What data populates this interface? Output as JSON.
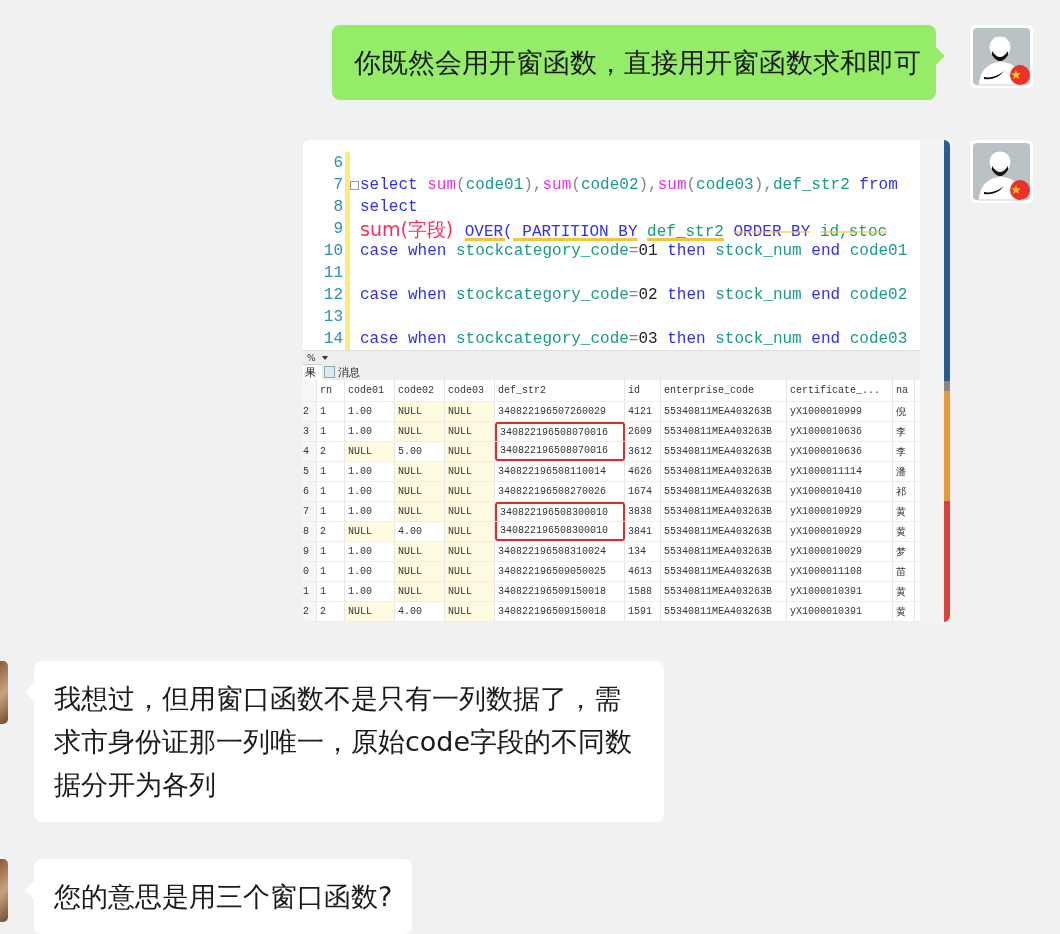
{
  "messages": [
    {
      "kind": "outgoing",
      "text": "你既然会用开窗函数，直接用开窗函数求和即可"
    },
    {
      "kind": "outgoing_image",
      "editor": {
        "lines": [
          {
            "number": "6",
            "collapsible": false
          },
          {
            "number": "7",
            "collapsible": true,
            "tokens": [
              {
                "kind": "keyword",
                "text": "select "
              },
              {
                "kind": "func",
                "text": "sum"
              },
              {
                "kind": "op",
                "text": "("
              },
              {
                "kind": "ident",
                "text": "code01"
              },
              {
                "kind": "op",
                "text": "),"
              },
              {
                "kind": "func",
                "text": "sum"
              },
              {
                "kind": "op",
                "text": "("
              },
              {
                "kind": "ident",
                "text": "code02"
              },
              {
                "kind": "op",
                "text": "),"
              },
              {
                "kind": "func",
                "text": "sum"
              },
              {
                "kind": "op",
                "text": "("
              },
              {
                "kind": "ident",
                "text": "code03"
              },
              {
                "kind": "op",
                "text": "),"
              },
              {
                "kind": "ident",
                "text": "def_str2 "
              },
              {
                "kind": "keyword",
                "text": "from"
              }
            ]
          },
          {
            "number": "8",
            "collapsible": false,
            "tokens": [
              {
                "kind": "keyword",
                "text": "select"
              }
            ]
          },
          {
            "number": "9",
            "collapsible": false,
            "tokens": [
              {
                "kind": "annotation",
                "text": "sum(字段)",
                "underlined": false,
                "struck_out": false
              },
              {
                "kind": "keyword",
                "text": "OVER( PARTITION BY",
                "underlined": true,
                "struck_out": false
              },
              {
                "kind": "ident",
                "text": "def_str2",
                "underlined": true,
                "struck_out": false
              },
              {
                "kind": "keyword",
                "text": "ORDER BY",
                "underlined": false,
                "struck_out": true
              },
              {
                "kind": "ident",
                "text": "id,stoc",
                "underlined": false,
                "struck_out": true
              }
            ]
          },
          {
            "number": "10",
            "collapsible": false,
            "tokens": [
              {
                "kind": "keyword",
                "text": "case when "
              },
              {
                "kind": "ident",
                "text": "stockcategory_code"
              },
              {
                "kind": "op",
                "text": "="
              },
              {
                "kind": "number",
                "text": "01"
              },
              {
                "kind": "keyword",
                "text": " then "
              },
              {
                "kind": "ident",
                "text": "stock_num "
              },
              {
                "kind": "keyword",
                "text": "end "
              },
              {
                "kind": "ident",
                "text": "code01"
              }
            ]
          },
          {
            "number": "11",
            "collapsible": false
          },
          {
            "number": "12",
            "collapsible": false,
            "tokens": [
              {
                "kind": "keyword",
                "text": "case when "
              },
              {
                "kind": "ident",
                "text": "stockcategory_code"
              },
              {
                "kind": "op",
                "text": "="
              },
              {
                "kind": "number",
                "text": "02"
              },
              {
                "kind": "keyword",
                "text": " then "
              },
              {
                "kind": "ident",
                "text": "stock_num "
              },
              {
                "kind": "keyword",
                "text": "end "
              },
              {
                "kind": "ident",
                "text": "code02"
              }
            ]
          },
          {
            "number": "13",
            "collapsible": false
          },
          {
            "number": "14",
            "collapsible": false,
            "tokens": [
              {
                "kind": "keyword",
                "text": "case when "
              },
              {
                "kind": "ident",
                "text": "stockcategory_code"
              },
              {
                "kind": "op",
                "text": "="
              },
              {
                "kind": "number",
                "text": "03"
              },
              {
                "kind": "keyword",
                "text": " then "
              },
              {
                "kind": "ident",
                "text": "stock_num "
              },
              {
                "kind": "keyword",
                "text": "end "
              },
              {
                "kind": "ident",
                "text": "code03"
              }
            ]
          }
        ]
      },
      "zoom": "%",
      "tabs": [
        {
          "label": "果",
          "selected": true
        },
        {
          "label": "消息",
          "selected": false
        }
      ],
      "grid": {
        "columns": [
          "rn",
          "code01",
          "code02",
          "code03",
          "def_str2",
          "id",
          "enterprise_code",
          "certificate_...",
          "na"
        ],
        "rows": [
          {
            "number": "2",
            "cells": [
              {
                "text": "1",
                "is_null": false,
                "boxed": false
              },
              {
                "text": "1.00",
                "is_null": false,
                "boxed": false
              },
              {
                "text": "NULL",
                "is_null": true,
                "boxed": false
              },
              {
                "text": "NULL",
                "is_null": true,
                "boxed": false
              },
              {
                "text": "340822196507260029",
                "is_null": false,
                "boxed": false
              },
              {
                "text": "4121",
                "is_null": false,
                "boxed": false
              },
              {
                "text": "55340811MEA403263B",
                "is_null": false,
                "boxed": false
              },
              {
                "text": "yX1000010999",
                "is_null": false,
                "boxed": false
              },
              {
                "text": "倪",
                "is_null": false,
                "boxed": false
              }
            ]
          },
          {
            "number": "3",
            "cells": [
              {
                "text": "1",
                "is_null": false,
                "boxed": false
              },
              {
                "text": "1.00",
                "is_null": false,
                "boxed": false
              },
              {
                "text": "NULL",
                "is_null": true,
                "boxed": false
              },
              {
                "text": "NULL",
                "is_null": true,
                "boxed": false
              },
              {
                "text": "340822196508070016",
                "is_null": false,
                "boxed": true
              },
              {
                "text": "2609",
                "is_null": false,
                "boxed": false
              },
              {
                "text": "55340811MEA403263B",
                "is_null": false,
                "boxed": false
              },
              {
                "text": "yX1000010636",
                "is_null": false,
                "boxed": false
              },
              {
                "text": "李",
                "is_null": false,
                "boxed": false
              }
            ]
          },
          {
            "number": "4",
            "cells": [
              {
                "text": "2",
                "is_null": false,
                "boxed": false
              },
              {
                "text": "NULL",
                "is_null": true,
                "boxed": false
              },
              {
                "text": "5.00",
                "is_null": false,
                "boxed": false
              },
              {
                "text": "NULL",
                "is_null": true,
                "boxed": false
              },
              {
                "text": "340822196508070016",
                "is_null": false,
                "boxed": true
              },
              {
                "text": "3612",
                "is_null": false,
                "boxed": false
              },
              {
                "text": "55340811MEA403263B",
                "is_null": false,
                "boxed": false
              },
              {
                "text": "yX1000010636",
                "is_null": false,
                "boxed": false
              },
              {
                "text": "李",
                "is_null": false,
                "boxed": false
              }
            ]
          },
          {
            "number": "5",
            "cells": [
              {
                "text": "1",
                "is_null": false,
                "boxed": false
              },
              {
                "text": "1.00",
                "is_null": false,
                "boxed": false
              },
              {
                "text": "NULL",
                "is_null": true,
                "boxed": false
              },
              {
                "text": "NULL",
                "is_null": true,
                "boxed": false
              },
              {
                "text": "340822196508110014",
                "is_null": false,
                "boxed": false
              },
              {
                "text": "4626",
                "is_null": false,
                "boxed": false
              },
              {
                "text": "55340811MEA403263B",
                "is_null": false,
                "boxed": false
              },
              {
                "text": "yX1000011114",
                "is_null": false,
                "boxed": false
              },
              {
                "text": "潘",
                "is_null": false,
                "boxed": false
              }
            ]
          },
          {
            "number": "6",
            "cells": [
              {
                "text": "1",
                "is_null": false,
                "boxed": false
              },
              {
                "text": "1.00",
                "is_null": false,
                "boxed": false
              },
              {
                "text": "NULL",
                "is_null": true,
                "boxed": false
              },
              {
                "text": "NULL",
                "is_null": true,
                "boxed": false
              },
              {
                "text": "340822196508270026",
                "is_null": false,
                "boxed": false
              },
              {
                "text": "1674",
                "is_null": false,
                "boxed": false
              },
              {
                "text": "55340811MEA403263B",
                "is_null": false,
                "boxed": false
              },
              {
                "text": "yX1000010410",
                "is_null": false,
                "boxed": false
              },
              {
                "text": "祁",
                "is_null": false,
                "boxed": false
              }
            ]
          },
          {
            "number": "7",
            "cells": [
              {
                "text": "1",
                "is_null": false,
                "boxed": false
              },
              {
                "text": "1.00",
                "is_null": false,
                "boxed": false
              },
              {
                "text": "NULL",
                "is_null": true,
                "boxed": false
              },
              {
                "text": "NULL",
                "is_null": true,
                "boxed": false
              },
              {
                "text": "340822196508300010",
                "is_null": false,
                "boxed": true
              },
              {
                "text": "3838",
                "is_null": false,
                "boxed": false
              },
              {
                "text": "55340811MEA403263B",
                "is_null": false,
                "boxed": false
              },
              {
                "text": "yX1000010929",
                "is_null": false,
                "boxed": false
              },
              {
                "text": "黄",
                "is_null": false,
                "boxed": false
              }
            ]
          },
          {
            "number": "8",
            "cells": [
              {
                "text": "2",
                "is_null": false,
                "boxed": false
              },
              {
                "text": "NULL",
                "is_null": true,
                "boxed": false
              },
              {
                "text": "4.00",
                "is_null": false,
                "boxed": false
              },
              {
                "text": "NULL",
                "is_null": true,
                "boxed": false
              },
              {
                "text": "340822196508300010",
                "is_null": false,
                "boxed": true
              },
              {
                "text": "3841",
                "is_null": false,
                "boxed": false
              },
              {
                "text": "55340811MEA403263B",
                "is_null": false,
                "boxed": false
              },
              {
                "text": "yX1000010929",
                "is_null": false,
                "boxed": false
              },
              {
                "text": "黄",
                "is_null": false,
                "boxed": false
              }
            ]
          },
          {
            "number": "9",
            "cells": [
              {
                "text": "1",
                "is_null": false,
                "boxed": false
              },
              {
                "text": "1.00",
                "is_null": false,
                "boxed": false
              },
              {
                "text": "NULL",
                "is_null": true,
                "boxed": false
              },
              {
                "text": "NULL",
                "is_null": true,
                "boxed": false
              },
              {
                "text": "340822196508310024",
                "is_null": false,
                "boxed": false
              },
              {
                "text": "134",
                "is_null": false,
                "boxed": false
              },
              {
                "text": "55340811MEA403263B",
                "is_null": false,
                "boxed": false
              },
              {
                "text": "yX1000010029",
                "is_null": false,
                "boxed": false
              },
              {
                "text": "梦",
                "is_null": false,
                "boxed": false
              }
            ]
          },
          {
            "number": "0",
            "cells": [
              {
                "text": "1",
                "is_null": false,
                "boxed": false
              },
              {
                "text": "1.00",
                "is_null": false,
                "boxed": false
              },
              {
                "text": "NULL",
                "is_null": true,
                "boxed": false
              },
              {
                "text": "NULL",
                "is_null": true,
                "boxed": false
              },
              {
                "text": "340822196509050025",
                "is_null": false,
                "boxed": false
              },
              {
                "text": "4613",
                "is_null": false,
                "boxed": false
              },
              {
                "text": "55340811MEA403263B",
                "is_null": false,
                "boxed": false
              },
              {
                "text": "yX1000011108",
                "is_null": false,
                "boxed": false
              },
              {
                "text": "苗",
                "is_null": false,
                "boxed": false
              }
            ]
          },
          {
            "number": "1",
            "cells": [
              {
                "text": "1",
                "is_null": false,
                "boxed": false
              },
              {
                "text": "1.00",
                "is_null": false,
                "boxed": false
              },
              {
                "text": "NULL",
                "is_null": true,
                "boxed": false
              },
              {
                "text": "NULL",
                "is_null": true,
                "boxed": false
              },
              {
                "text": "340822196509150018",
                "is_null": false,
                "boxed": false
              },
              {
                "text": "1588",
                "is_null": false,
                "boxed": false
              },
              {
                "text": "55340811MEA403263B",
                "is_null": false,
                "boxed": false
              },
              {
                "text": "yX1000010391",
                "is_null": false,
                "boxed": false
              },
              {
                "text": "黄",
                "is_null": false,
                "boxed": false
              }
            ]
          },
          {
            "number": "2",
            "cells": [
              {
                "text": "2",
                "is_null": false,
                "boxed": false
              },
              {
                "text": "NULL",
                "is_null": true,
                "boxed": false
              },
              {
                "text": "4.00",
                "is_null": false,
                "boxed": false
              },
              {
                "text": "NULL",
                "is_null": true,
                "boxed": false
              },
              {
                "text": "340822196509150018",
                "is_null": false,
                "boxed": false
              },
              {
                "text": "1591",
                "is_null": false,
                "boxed": false
              },
              {
                "text": "55340811MEA403263B",
                "is_null": false,
                "boxed": false
              },
              {
                "text": "yX1000010391",
                "is_null": false,
                "boxed": false
              },
              {
                "text": "黄",
                "is_null": false,
                "boxed": false
              }
            ]
          }
        ]
      }
    },
    {
      "kind": "incoming",
      "text": "我想过，但用窗口函数不是只有一列数据了，需求市身份证那一列唯一，原始code字段的不同数据分开为各列"
    },
    {
      "kind": "incoming",
      "text": "您的意思是用三个窗口函数?"
    }
  ]
}
